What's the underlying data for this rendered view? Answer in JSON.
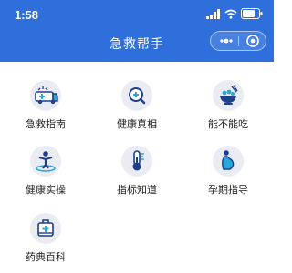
{
  "status": {
    "time": "1:58"
  },
  "header": {
    "title": "急救帮手"
  },
  "items": [
    {
      "label": "急救指南",
      "icon": "ambulance-icon"
    },
    {
      "label": "健康真相",
      "icon": "magnifier-plus-icon"
    },
    {
      "label": "能不能吃",
      "icon": "food-bowl-icon"
    },
    {
      "label": "健康实操",
      "icon": "person-exercise-icon"
    },
    {
      "label": "指标知道",
      "icon": "thermometer-icon"
    },
    {
      "label": "孕期指导",
      "icon": "pregnant-woman-icon"
    },
    {
      "label": "药典百科",
      "icon": "medicine-box-icon"
    }
  ],
  "colors": {
    "header_bg": "#2f6fdc",
    "icon_bg": "#e9ecf3",
    "icon_primary": "#1f3f8a",
    "icon_accent": "#2aa7d8"
  }
}
